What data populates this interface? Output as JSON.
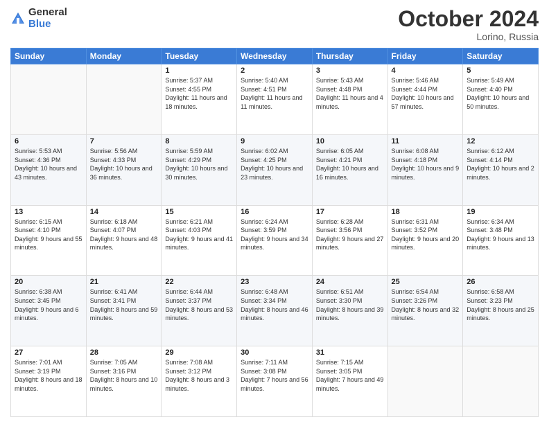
{
  "logo": {
    "general": "General",
    "blue": "Blue"
  },
  "header": {
    "month": "October 2024",
    "location": "Lorino, Russia"
  },
  "weekdays": [
    "Sunday",
    "Monday",
    "Tuesday",
    "Wednesday",
    "Thursday",
    "Friday",
    "Saturday"
  ],
  "weeks": [
    [
      {
        "day": "",
        "sunrise": "",
        "sunset": "",
        "daylight": ""
      },
      {
        "day": "",
        "sunrise": "",
        "sunset": "",
        "daylight": ""
      },
      {
        "day": "1",
        "sunrise": "Sunrise: 5:37 AM",
        "sunset": "Sunset: 4:55 PM",
        "daylight": "Daylight: 11 hours and 18 minutes."
      },
      {
        "day": "2",
        "sunrise": "Sunrise: 5:40 AM",
        "sunset": "Sunset: 4:51 PM",
        "daylight": "Daylight: 11 hours and 11 minutes."
      },
      {
        "day": "3",
        "sunrise": "Sunrise: 5:43 AM",
        "sunset": "Sunset: 4:48 PM",
        "daylight": "Daylight: 11 hours and 4 minutes."
      },
      {
        "day": "4",
        "sunrise": "Sunrise: 5:46 AM",
        "sunset": "Sunset: 4:44 PM",
        "daylight": "Daylight: 10 hours and 57 minutes."
      },
      {
        "day": "5",
        "sunrise": "Sunrise: 5:49 AM",
        "sunset": "Sunset: 4:40 PM",
        "daylight": "Daylight: 10 hours and 50 minutes."
      }
    ],
    [
      {
        "day": "6",
        "sunrise": "Sunrise: 5:53 AM",
        "sunset": "Sunset: 4:36 PM",
        "daylight": "Daylight: 10 hours and 43 minutes."
      },
      {
        "day": "7",
        "sunrise": "Sunrise: 5:56 AM",
        "sunset": "Sunset: 4:33 PM",
        "daylight": "Daylight: 10 hours and 36 minutes."
      },
      {
        "day": "8",
        "sunrise": "Sunrise: 5:59 AM",
        "sunset": "Sunset: 4:29 PM",
        "daylight": "Daylight: 10 hours and 30 minutes."
      },
      {
        "day": "9",
        "sunrise": "Sunrise: 6:02 AM",
        "sunset": "Sunset: 4:25 PM",
        "daylight": "Daylight: 10 hours and 23 minutes."
      },
      {
        "day": "10",
        "sunrise": "Sunrise: 6:05 AM",
        "sunset": "Sunset: 4:21 PM",
        "daylight": "Daylight: 10 hours and 16 minutes."
      },
      {
        "day": "11",
        "sunrise": "Sunrise: 6:08 AM",
        "sunset": "Sunset: 4:18 PM",
        "daylight": "Daylight: 10 hours and 9 minutes."
      },
      {
        "day": "12",
        "sunrise": "Sunrise: 6:12 AM",
        "sunset": "Sunset: 4:14 PM",
        "daylight": "Daylight: 10 hours and 2 minutes."
      }
    ],
    [
      {
        "day": "13",
        "sunrise": "Sunrise: 6:15 AM",
        "sunset": "Sunset: 4:10 PM",
        "daylight": "Daylight: 9 hours and 55 minutes."
      },
      {
        "day": "14",
        "sunrise": "Sunrise: 6:18 AM",
        "sunset": "Sunset: 4:07 PM",
        "daylight": "Daylight: 9 hours and 48 minutes."
      },
      {
        "day": "15",
        "sunrise": "Sunrise: 6:21 AM",
        "sunset": "Sunset: 4:03 PM",
        "daylight": "Daylight: 9 hours and 41 minutes."
      },
      {
        "day": "16",
        "sunrise": "Sunrise: 6:24 AM",
        "sunset": "Sunset: 3:59 PM",
        "daylight": "Daylight: 9 hours and 34 minutes."
      },
      {
        "day": "17",
        "sunrise": "Sunrise: 6:28 AM",
        "sunset": "Sunset: 3:56 PM",
        "daylight": "Daylight: 9 hours and 27 minutes."
      },
      {
        "day": "18",
        "sunrise": "Sunrise: 6:31 AM",
        "sunset": "Sunset: 3:52 PM",
        "daylight": "Daylight: 9 hours and 20 minutes."
      },
      {
        "day": "19",
        "sunrise": "Sunrise: 6:34 AM",
        "sunset": "Sunset: 3:48 PM",
        "daylight": "Daylight: 9 hours and 13 minutes."
      }
    ],
    [
      {
        "day": "20",
        "sunrise": "Sunrise: 6:38 AM",
        "sunset": "Sunset: 3:45 PM",
        "daylight": "Daylight: 9 hours and 6 minutes."
      },
      {
        "day": "21",
        "sunrise": "Sunrise: 6:41 AM",
        "sunset": "Sunset: 3:41 PM",
        "daylight": "Daylight: 8 hours and 59 minutes."
      },
      {
        "day": "22",
        "sunrise": "Sunrise: 6:44 AM",
        "sunset": "Sunset: 3:37 PM",
        "daylight": "Daylight: 8 hours and 53 minutes."
      },
      {
        "day": "23",
        "sunrise": "Sunrise: 6:48 AM",
        "sunset": "Sunset: 3:34 PM",
        "daylight": "Daylight: 8 hours and 46 minutes."
      },
      {
        "day": "24",
        "sunrise": "Sunrise: 6:51 AM",
        "sunset": "Sunset: 3:30 PM",
        "daylight": "Daylight: 8 hours and 39 minutes."
      },
      {
        "day": "25",
        "sunrise": "Sunrise: 6:54 AM",
        "sunset": "Sunset: 3:26 PM",
        "daylight": "Daylight: 8 hours and 32 minutes."
      },
      {
        "day": "26",
        "sunrise": "Sunrise: 6:58 AM",
        "sunset": "Sunset: 3:23 PM",
        "daylight": "Daylight: 8 hours and 25 minutes."
      }
    ],
    [
      {
        "day": "27",
        "sunrise": "Sunrise: 7:01 AM",
        "sunset": "Sunset: 3:19 PM",
        "daylight": "Daylight: 8 hours and 18 minutes."
      },
      {
        "day": "28",
        "sunrise": "Sunrise: 7:05 AM",
        "sunset": "Sunset: 3:16 PM",
        "daylight": "Daylight: 8 hours and 10 minutes."
      },
      {
        "day": "29",
        "sunrise": "Sunrise: 7:08 AM",
        "sunset": "Sunset: 3:12 PM",
        "daylight": "Daylight: 8 hours and 3 minutes."
      },
      {
        "day": "30",
        "sunrise": "Sunrise: 7:11 AM",
        "sunset": "Sunset: 3:08 PM",
        "daylight": "Daylight: 7 hours and 56 minutes."
      },
      {
        "day": "31",
        "sunrise": "Sunrise: 7:15 AM",
        "sunset": "Sunset: 3:05 PM",
        "daylight": "Daylight: 7 hours and 49 minutes."
      },
      {
        "day": "",
        "sunrise": "",
        "sunset": "",
        "daylight": ""
      },
      {
        "day": "",
        "sunrise": "",
        "sunset": "",
        "daylight": ""
      }
    ]
  ]
}
